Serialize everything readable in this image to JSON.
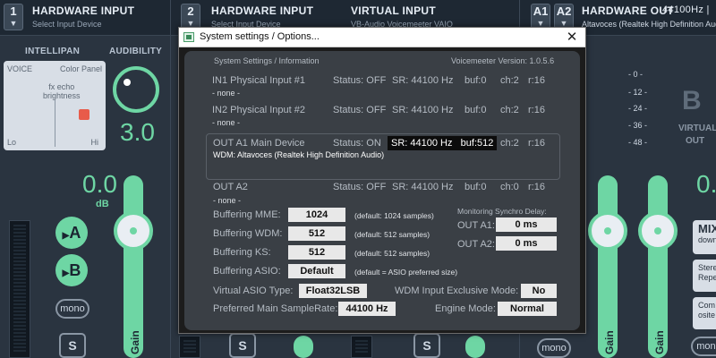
{
  "background": {
    "strip1": {
      "number": "1",
      "title": "HARDWARE INPUT",
      "subtitle": "Select Input Device"
    },
    "strip2": {
      "number": "2",
      "title": "HARDWARE INPUT",
      "subtitle": "Select Input Device"
    },
    "virtual_input": {
      "title": "VIRTUAL INPUT",
      "subtitle": "VB-Audio Voicemeeter VAIO"
    },
    "bus_buttons": [
      "A1",
      "A2"
    ],
    "hardware_out": {
      "title": "HARDWARE OUT",
      "info": "44100Hz |",
      "subtitle": "Altavoces (Realtek High Definition Aud"
    },
    "intellipan_label": "INTELLIPAN",
    "audibility_label": "AUDIBILITY",
    "intellipan": {
      "voice": "VOICE",
      "color_panel": "Color Panel",
      "fx_echo": "fx echo",
      "brightness": "brightness",
      "lo": "Lo",
      "hi": "Hi"
    },
    "audibility_value": "3.0",
    "gain_value_left": "0.0",
    "gain_value_right": "0.",
    "db_unit": "dB",
    "btn_a": "A",
    "btn_b": "B",
    "mono": "mono",
    "solo": "S",
    "gain_label": "Gain",
    "db_scale": [
      "- 0 -",
      "- 12 -",
      "- 24 -",
      "- 36 -",
      "- 48 -"
    ],
    "bus_letter": "B",
    "virtual_label": "VIRTUAL",
    "out_label": "OUT",
    "side_buttons": {
      "mix": "MIX",
      "mix_sub": "down",
      "stereo": "Stere",
      "stereo_sub": "Repea",
      "comp": "Com",
      "comp_sub": "osite"
    }
  },
  "dialog": {
    "title": "System settings / Options...",
    "close": "✕",
    "section_header": "System Settings / Information",
    "version": "Voicemeeter Version: 1.0.5.6",
    "in1": {
      "label": "IN1 Physical Input #1",
      "status": "Status: OFF",
      "sr": "SR: 44100 Hz",
      "buf": "buf:0",
      "ch": "ch:2",
      "r": "r:16",
      "device": "- none -"
    },
    "in2": {
      "label": "IN2 Physical Input #2",
      "status": "Status: OFF",
      "sr": "SR: 44100 Hz",
      "buf": "buf:0",
      "ch": "ch:2",
      "r": "r:16",
      "device": "- none -"
    },
    "outa1": {
      "label": "OUT A1 Main Device",
      "status": "Status: ON",
      "sr": "SR: 44100 Hz",
      "buf": "buf:512",
      "ch": "ch:2",
      "r": "r:16",
      "device": "WDM: Altavoces (Realtek High Definition Audio)"
    },
    "outa2": {
      "label": "OUT A2",
      "status": "Status: OFF",
      "sr": "SR: 44100 Hz",
      "buf": "buf:0",
      "ch": "ch:0",
      "r": "r:16",
      "device": "- none -"
    },
    "buffering": {
      "mme": {
        "label": "Buffering MME:",
        "value": "1024",
        "note": "(default: 1024 samples)"
      },
      "wdm": {
        "label": "Buffering WDM:",
        "value": "512",
        "note": "(default: 512 samples)"
      },
      "ks": {
        "label": "Buffering KS:",
        "value": "512",
        "note": "(default: 512 samples)"
      },
      "asio": {
        "label": "Buffering ASIO:",
        "value": "Default",
        "note": "(default = ASIO preferred size)"
      }
    },
    "sync": {
      "header": "Monitoring Synchro Delay:",
      "a1_label": "OUT A1:",
      "a1_value": "0 ms",
      "a2_label": "OUT A2:",
      "a2_value": "0 ms"
    },
    "asio_type": {
      "label": "Virtual ASIO Type:",
      "value": "Float32LSB"
    },
    "wdm_exclusive": {
      "label": "WDM Input Exclusive Mode:",
      "value": "No"
    },
    "samplerate": {
      "label": "Preferred Main SampleRate:",
      "value": "44100 Hz"
    },
    "engine": {
      "label": "Engine Mode:",
      "value": "Normal"
    }
  }
}
